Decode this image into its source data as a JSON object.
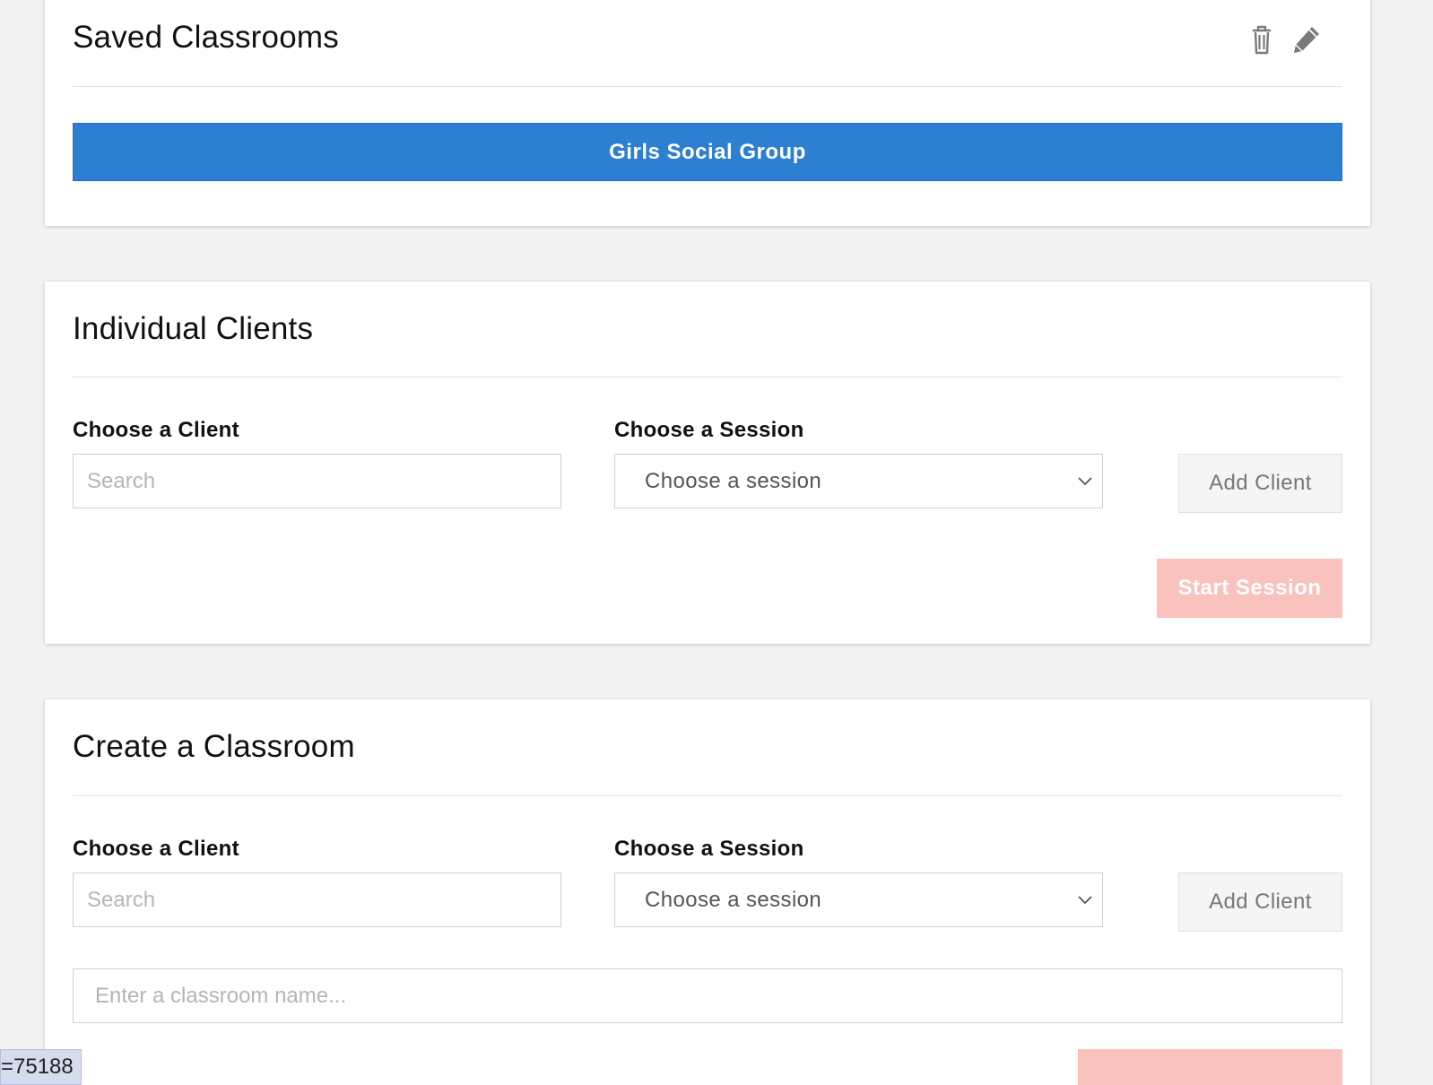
{
  "saved_classrooms": {
    "title": "Saved Classrooms",
    "delete_icon": "trash-icon",
    "edit_icon": "pencil-icon",
    "classroom_button_label": "Girls Social Group"
  },
  "individual_clients": {
    "title": "Individual Clients",
    "client_label": "Choose a Client",
    "client_placeholder": "Search",
    "session_label": "Choose a Session",
    "session_value": "Choose a session",
    "add_client_label": "Add Client",
    "start_session_label": "Start Session"
  },
  "create_classroom": {
    "title": "Create a Classroom",
    "client_label": "Choose a Client",
    "client_placeholder": "Search",
    "session_label": "Choose a Session",
    "session_value": "Choose a session",
    "add_client_label": "Add Client",
    "classroom_name_placeholder": "Enter a classroom name..."
  },
  "debug_tag": "=75188",
  "colors": {
    "primary": "#2d7fd1",
    "start_disabled": "#f9c2bd",
    "background": "#f3f3f3"
  }
}
